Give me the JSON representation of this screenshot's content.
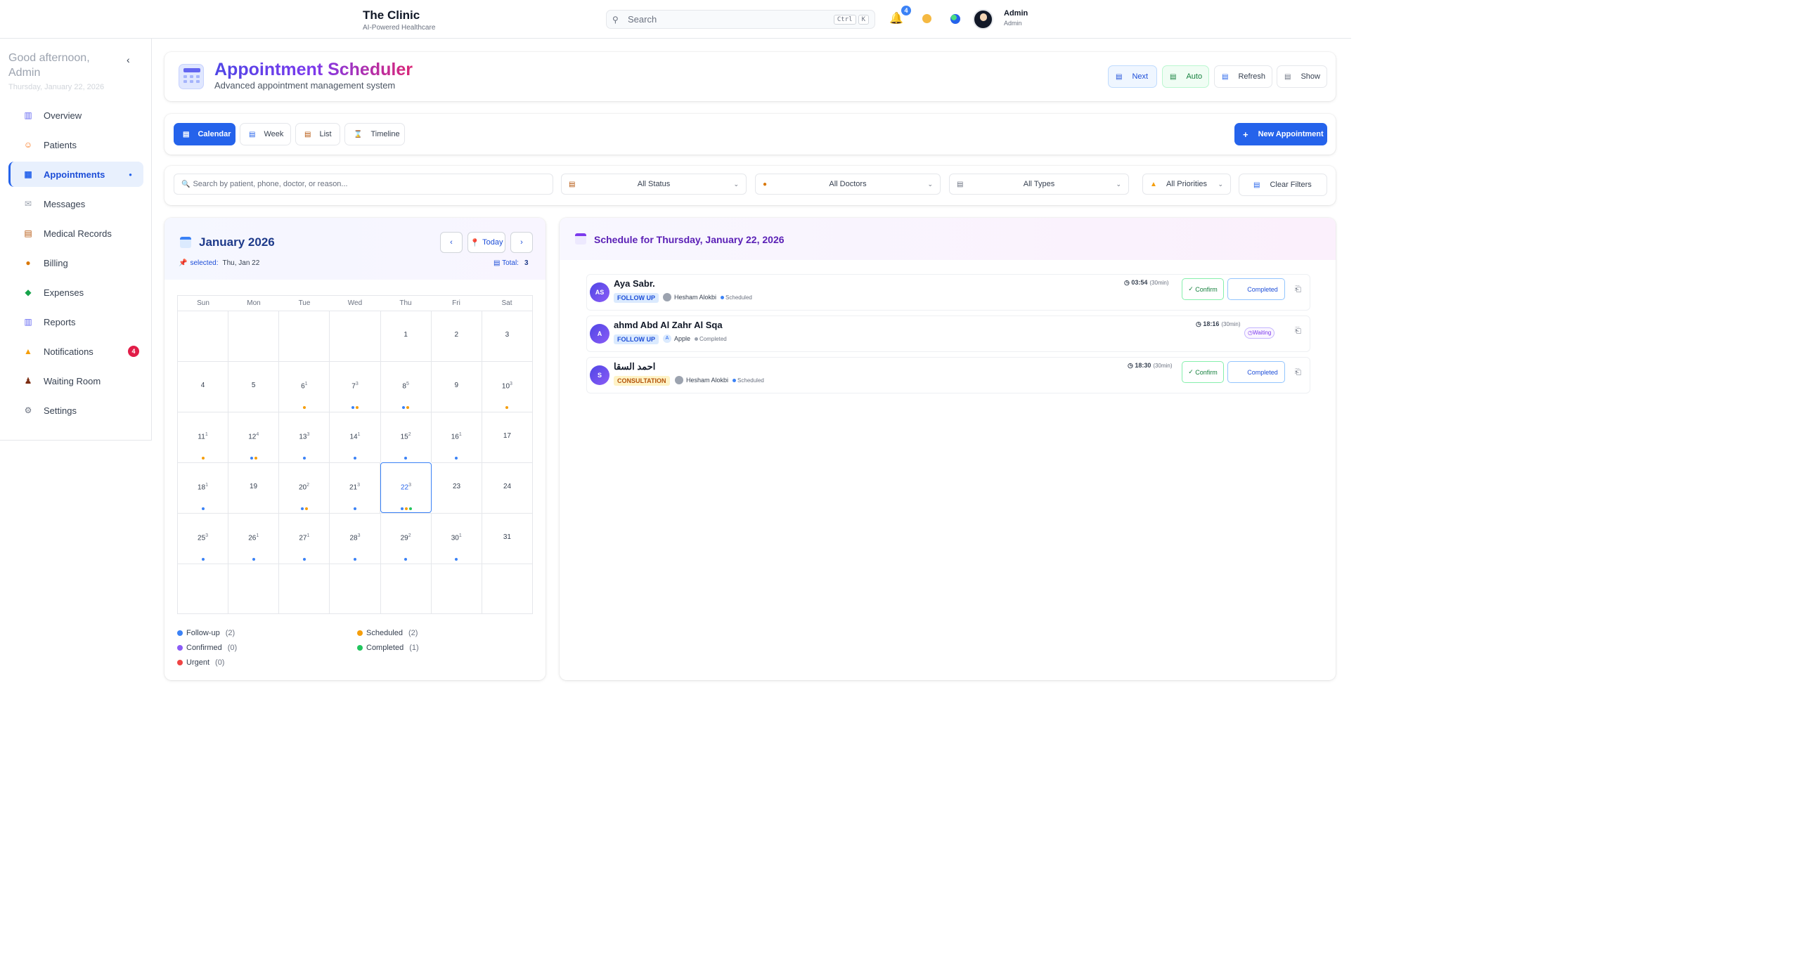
{
  "topbar": {
    "app_name": "The Clinic",
    "app_sub": "AI-Powered Healthcare",
    "search_placeholder": "Search",
    "kbd_ctrl": "Ctrl",
    "kbd_k": "K",
    "notif_count": "4",
    "user_name": "Admin",
    "user_role": "Admin"
  },
  "sidebar": {
    "greeting": "Good afternoon, Admin",
    "date": "Thursday, January 22, 2026",
    "items": [
      {
        "label": "Overview",
        "icon": "chart-icon"
      },
      {
        "label": "Patients",
        "icon": "patient-icon"
      },
      {
        "label": "Appointments",
        "icon": "calendar-icon"
      },
      {
        "label": "Messages",
        "icon": "message-icon"
      },
      {
        "label": "Medical Records",
        "icon": "clipboard-icon"
      },
      {
        "label": "Billing",
        "icon": "money-bag-icon"
      },
      {
        "label": "Expenses",
        "icon": "money-icon"
      },
      {
        "label": "Reports",
        "icon": "report-icon"
      },
      {
        "label": "Notifications",
        "icon": "bell-icon",
        "badge": "4"
      },
      {
        "label": "Waiting Room",
        "icon": "waiting-icon"
      },
      {
        "label": "Settings",
        "icon": "gear-icon"
      }
    ]
  },
  "header": {
    "title": "Appointment Scheduler",
    "subtitle": "Advanced appointment management system",
    "buttons": {
      "next": "Next",
      "auto": "Auto",
      "refresh": "Refresh",
      "show": "Show"
    }
  },
  "tabs": {
    "calendar": "Calendar",
    "week": "Week",
    "list": "List",
    "timeline": "Timeline",
    "new_appointment": "New Appointment"
  },
  "filters": {
    "search_placeholder": "Search by patient, phone, doctor, or reason...",
    "status": "All Status",
    "doctors": "All Doctors",
    "types": "All Types",
    "priorities": "All Priorities",
    "clear": "Clear Filters"
  },
  "calendar": {
    "month": "January 2026",
    "selected_label": "selected:",
    "selected_value": "Thu, Jan 22",
    "total_label": "Total:",
    "total_value": "3",
    "today": "Today",
    "weekdays": [
      "Sun",
      "Mon",
      "Tue",
      "Wed",
      "Thu",
      "Fri",
      "Sat"
    ],
    "selected_day": 22,
    "weeks": [
      [
        null,
        null,
        null,
        null,
        {
          "d": "1"
        },
        {
          "d": "2"
        },
        {
          "d": "3"
        }
      ],
      [
        {
          "d": "4"
        },
        {
          "d": "5"
        },
        {
          "d": "6",
          "c": "1",
          "dots": [
            "#f59e0b"
          ]
        },
        {
          "d": "7",
          "c": "3",
          "dots": [
            "#3b82f6",
            "#f59e0b"
          ]
        },
        {
          "d": "8",
          "c": "5",
          "dots": [
            "#3b82f6",
            "#f59e0b"
          ]
        },
        {
          "d": "9"
        },
        {
          "d": "10",
          "c": "3",
          "dots": [
            "#f59e0b"
          ]
        }
      ],
      [
        {
          "d": "11",
          "c": "1",
          "dots": [
            "#f59e0b"
          ]
        },
        {
          "d": "12",
          "c": "4",
          "dots": [
            "#3b82f6",
            "#f59e0b"
          ]
        },
        {
          "d": "13",
          "c": "3",
          "dots": [
            "#3b82f6"
          ]
        },
        {
          "d": "14",
          "c": "1",
          "dots": [
            "#3b82f6"
          ]
        },
        {
          "d": "15",
          "c": "2",
          "dots": [
            "#3b82f6"
          ]
        },
        {
          "d": "16",
          "c": "1",
          "dots": [
            "#3b82f6"
          ]
        },
        {
          "d": "17"
        }
      ],
      [
        {
          "d": "18",
          "c": "1",
          "dots": [
            "#3b82f6"
          ]
        },
        {
          "d": "19"
        },
        {
          "d": "20",
          "c": "2",
          "dots": [
            "#3b82f6",
            "#f59e0b"
          ]
        },
        {
          "d": "21",
          "c": "3",
          "dots": [
            "#3b82f6"
          ]
        },
        {
          "d": "22",
          "c": "3",
          "dots": [
            "#3b82f6",
            "#f59e0b",
            "#22c55e"
          ]
        },
        {
          "d": "23"
        },
        {
          "d": "24"
        }
      ],
      [
        {
          "d": "25",
          "c": "3",
          "dots": [
            "#3b82f6"
          ]
        },
        {
          "d": "26",
          "c": "1",
          "dots": [
            "#3b82f6"
          ]
        },
        {
          "d": "27",
          "c": "1",
          "dots": [
            "#3b82f6"
          ]
        },
        {
          "d": "28",
          "c": "3",
          "dots": [
            "#3b82f6"
          ]
        },
        {
          "d": "29",
          "c": "2",
          "dots": [
            "#3b82f6"
          ]
        },
        {
          "d": "30",
          "c": "1",
          "dots": [
            "#3b82f6"
          ]
        },
        {
          "d": "31"
        }
      ],
      [
        null,
        null,
        null,
        null,
        null,
        null,
        null
      ]
    ],
    "legend": [
      {
        "label": "Follow-up",
        "count": "(2)",
        "color": "#3b82f6"
      },
      {
        "label": "Scheduled",
        "count": "(2)",
        "color": "#f59e0b"
      },
      {
        "label": "Confirmed",
        "count": "(0)",
        "color": "#8b5cf6"
      },
      {
        "label": "Completed",
        "count": "(1)",
        "color": "#22c55e"
      },
      {
        "label": "Urgent",
        "count": "(0)",
        "color": "#ef4444"
      }
    ]
  },
  "schedule": {
    "title": "Schedule for Thursday, January 22, 2026",
    "appointments": [
      {
        "initials": "AS",
        "name": "Aya Sabr.",
        "type": "FOLLOW UP",
        "doctor": "Hesham Alokbi",
        "doctor_initial": "",
        "status": "Scheduled",
        "status_color": "#3b82f6",
        "time": "03:54",
        "duration": "(30min)",
        "actions": [
          "Confirm",
          "Completed"
        ]
      },
      {
        "initials": "A",
        "name": "ahmd Abd Al Zahr Al Sqa",
        "type": "FOLLOW UP",
        "doctor": "Apple",
        "doctor_initial": "A",
        "status": "Completed",
        "status_color": "#9ca3af",
        "time": "18:16",
        "duration": "(30min)",
        "waiting": "Waiting"
      },
      {
        "initials": "S",
        "name": "احمد السقا",
        "type": "CONSULTATION",
        "doctor": "Hesham Alokbi",
        "doctor_initial": "",
        "status": "Scheduled",
        "status_color": "#3b82f6",
        "time": "18:30",
        "duration": "(30min)",
        "actions": [
          "Confirm",
          "Completed"
        ]
      }
    ]
  }
}
